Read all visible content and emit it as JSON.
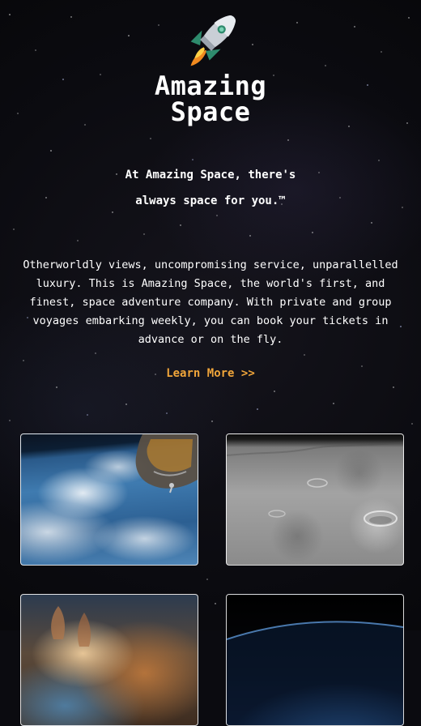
{
  "brand": {
    "line1": "Amazing",
    "line2": "Space"
  },
  "tagline": {
    "line1": "At Amazing Space, there's",
    "line2": "always space for you.™"
  },
  "description": "Otherworldly views, uncompromising service, unparallelled luxury. This is Amazing Space, the world's first, and finest, space adventure company. With private and group voyages embarking weekly, you can book your tickets in advance or on the fly.",
  "cta": {
    "label": "Learn More >>"
  },
  "gallery": {
    "images": [
      {
        "subject": "earth-with-space-station"
      },
      {
        "subject": "lunar-surface"
      },
      {
        "subject": "nebula-pillars"
      },
      {
        "subject": "earth-horizon"
      }
    ]
  },
  "colors": {
    "background": "#0b0b10",
    "text": "#ffffff",
    "accent": "#f0a53a",
    "card_border": "#ffffff"
  }
}
